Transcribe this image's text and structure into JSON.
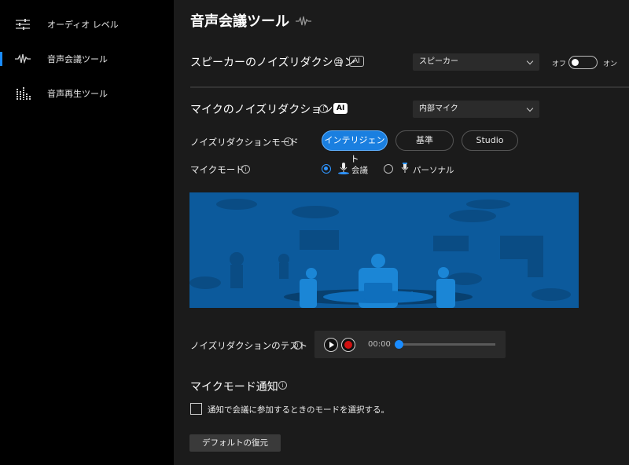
{
  "sidebar": {
    "items": [
      {
        "label": "オーディオ レベル",
        "icon": "sliders-icon",
        "selected": false
      },
      {
        "label": "音声会議ツール",
        "icon": "waveform-icon",
        "selected": true
      },
      {
        "label": "音声再生ツール",
        "icon": "equalizer-icon",
        "selected": false
      }
    ]
  },
  "main": {
    "title": "音声会議ツール",
    "title_icon": "waveform-icon",
    "speaker_nr": {
      "label": "スピーカーのノイズリダクション",
      "ai_badge": "AI",
      "dropdown_value": "スピーカー",
      "toggle_off_label": "オフ",
      "toggle_on_label": "オン",
      "toggle_on": false
    },
    "mic_nr": {
      "label": "マイクのノイズリダクション",
      "ai_badge": "AI",
      "dropdown_value": "内部マイク"
    },
    "nr_mode": {
      "label": "ノイズリダクションモード",
      "options": [
        "インテリジェント",
        "基準",
        "Studio"
      ],
      "selected": "インテリジェント"
    },
    "mic_mode": {
      "label": "マイクモード",
      "options": [
        {
          "label": "会議",
          "selected": true
        },
        {
          "label": "パーソナル",
          "selected": false
        }
      ]
    },
    "nr_test": {
      "label": "ノイズリダクションのテスト",
      "time": "00:00",
      "progress": 0
    },
    "notification": {
      "title": "マイクモード通知",
      "checkbox_label": "通知で会議に参加するときのモードを選択する。",
      "checked": false
    },
    "restore_button": "デフォルトの復元"
  },
  "colors": {
    "accent": "#1a7fe0",
    "sidebar_bg": "#000000",
    "main_bg": "#1b1b1b",
    "scene_bg": "#0c5a9c",
    "record": "#d01010"
  }
}
